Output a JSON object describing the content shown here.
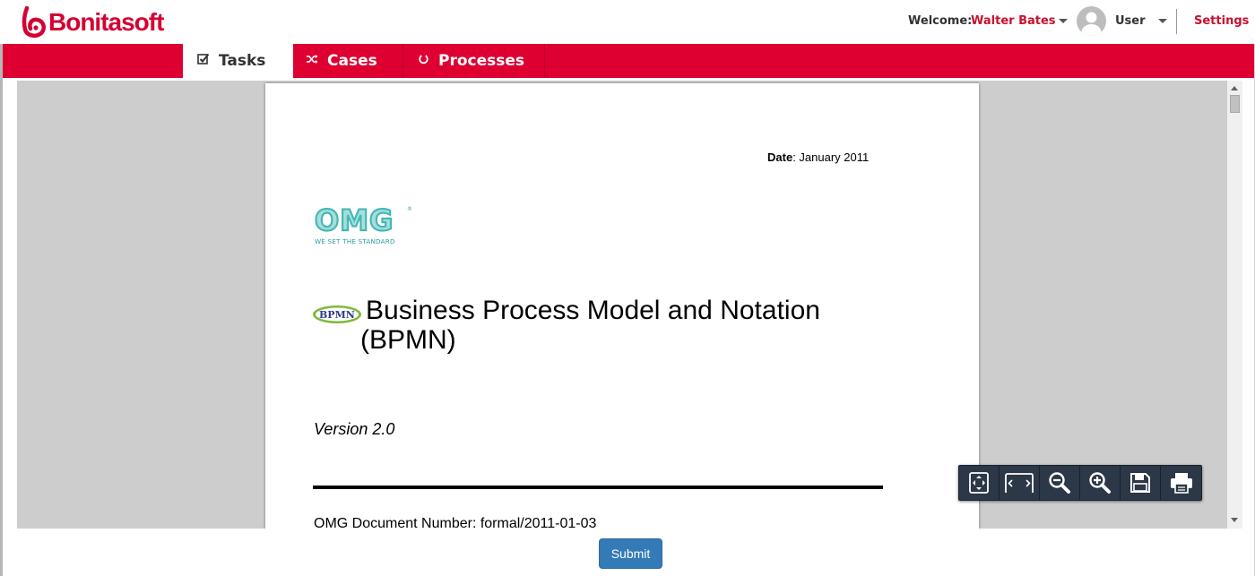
{
  "header": {
    "brand": "Bonitasoft",
    "welcome_label": "Welcome:",
    "user_full_name": "Walter Bates",
    "user_menu_label": "User",
    "settings_label": "Settings"
  },
  "nav": {
    "tabs": [
      {
        "label": "Tasks",
        "icon": "check-square-icon",
        "active": true
      },
      {
        "label": "Cases",
        "icon": "shuffle-icon",
        "active": false
      },
      {
        "label": "Processes",
        "icon": "cog-icon",
        "active": false
      }
    ]
  },
  "document": {
    "date_label": "Date",
    "date_value": ": January 2011",
    "omg_logo_text": "OMG",
    "omg_tagline": "WE SET THE STANDARD",
    "bpmn_logo_text": "BPMN",
    "title_line1": "Business Process Model and Notation",
    "title_line2": "(BPMN)",
    "version": "Version 2.0",
    "doc_number": "OMG Document Number:  formal/2011-01-03"
  },
  "viewer_toolbar": {
    "buttons": [
      "fit-page-icon",
      "fit-width-icon",
      "zoom-out-icon",
      "zoom-in-icon",
      "save-icon",
      "print-icon"
    ]
  },
  "form": {
    "submit_label": "Submit"
  },
  "colors": {
    "brand_red": "#dd0031",
    "link_red": "#c8102e",
    "submit_blue": "#337ab7",
    "toolbar_bg": "#2c3747"
  }
}
